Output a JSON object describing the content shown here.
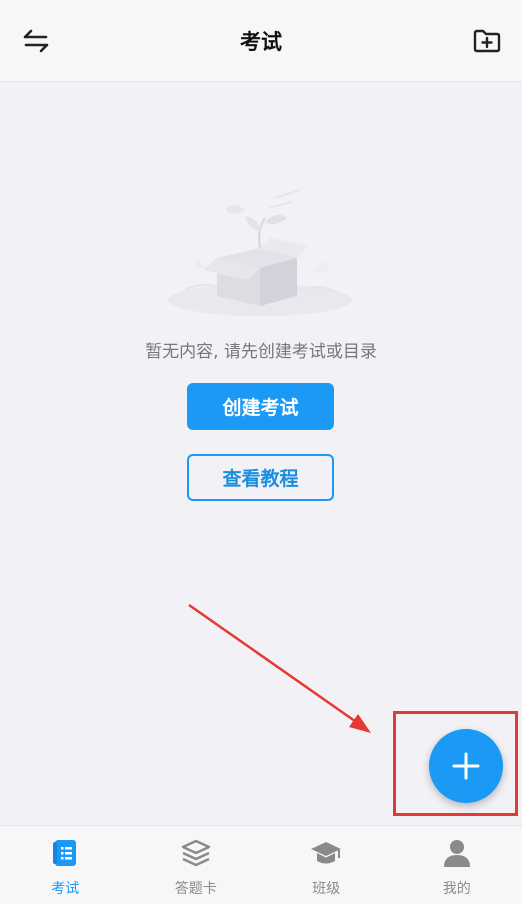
{
  "header": {
    "title": "考试",
    "left_icon": "swap-arrows-icon",
    "right_icon": "folder-add-icon"
  },
  "empty_state": {
    "message": "暂无内容, 请先创建考试或目录",
    "illustration": "empty-box-illustration"
  },
  "actions": {
    "create_exam_label": "创建考试",
    "tutorial_label": "查看教程"
  },
  "fab": {
    "icon": "plus-icon"
  },
  "tabbar": {
    "items": [
      {
        "label": "考试",
        "icon": "exam-book-icon",
        "active": true
      },
      {
        "label": "答题卡",
        "icon": "layers-icon",
        "active": false
      },
      {
        "label": "班级",
        "icon": "graduation-cap-icon",
        "active": false
      },
      {
        "label": "我的",
        "icon": "user-icon",
        "active": false
      }
    ]
  },
  "colors": {
    "accent": "#1a99f5",
    "background": "#f2f1f6",
    "annotation": "#e53935",
    "inactive": "#8a8a8a"
  }
}
